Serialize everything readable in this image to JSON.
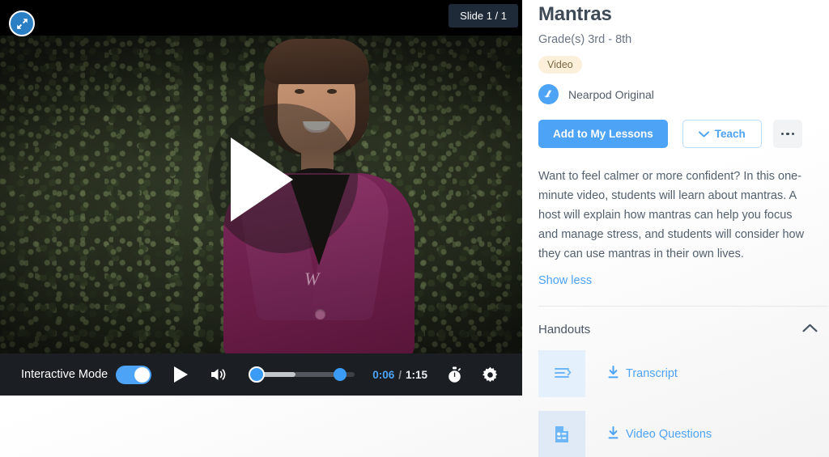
{
  "player": {
    "expand_icon": "expand-arrows-icon",
    "slide_indicator": "Slide 1 / 1",
    "play_overlay_icon": "play-icon",
    "controls": {
      "interactive_mode_label": "Interactive Mode",
      "interactive_mode_on": true,
      "play_icon": "play-icon",
      "volume_icon": "volume-up-icon",
      "seek_icon": "seek-slider",
      "current_time": "0:06",
      "time_separator": "/",
      "total_time": "1:15",
      "timer_icon": "stopwatch-icon",
      "settings_icon": "gear-icon"
    }
  },
  "panel": {
    "title": "Mantras",
    "grades": "Grade(s) 3rd - 8th",
    "badge": "Video",
    "origin": {
      "icon": "nearpod-logo-icon",
      "label": "Nearpod Original"
    },
    "buttons": {
      "add": "Add to My Lessons",
      "teach": "Teach",
      "teach_icon": "chevron-down-icon",
      "more_icon": "more-horizontal-icon"
    },
    "description": "Want to feel calmer or more confident? In this one-minute video, students will learn about mantras. A host will explain how mantras can help you focus and manage stress, and students will consider how they can use mantras in their own lives.",
    "show_toggle": "Show less",
    "handouts": {
      "title": "Handouts",
      "collapse_icon": "chevron-up-icon",
      "items": [
        {
          "label": "Transcript",
          "thumb_icon": "transcript-lines-icon",
          "download_icon": "download-icon"
        },
        {
          "label": "Video Questions",
          "thumb_icon": "document-questions-icon",
          "download_icon": "download-icon"
        }
      ]
    }
  },
  "colors": {
    "accent_blue": "#4da3f5",
    "badge_bg": "#fcf0da",
    "badge_text": "#7a6842",
    "control_bar_bg": "#1b1f24",
    "title_text": "#3f4a57",
    "thumb_bg": "#e4f1fd"
  }
}
